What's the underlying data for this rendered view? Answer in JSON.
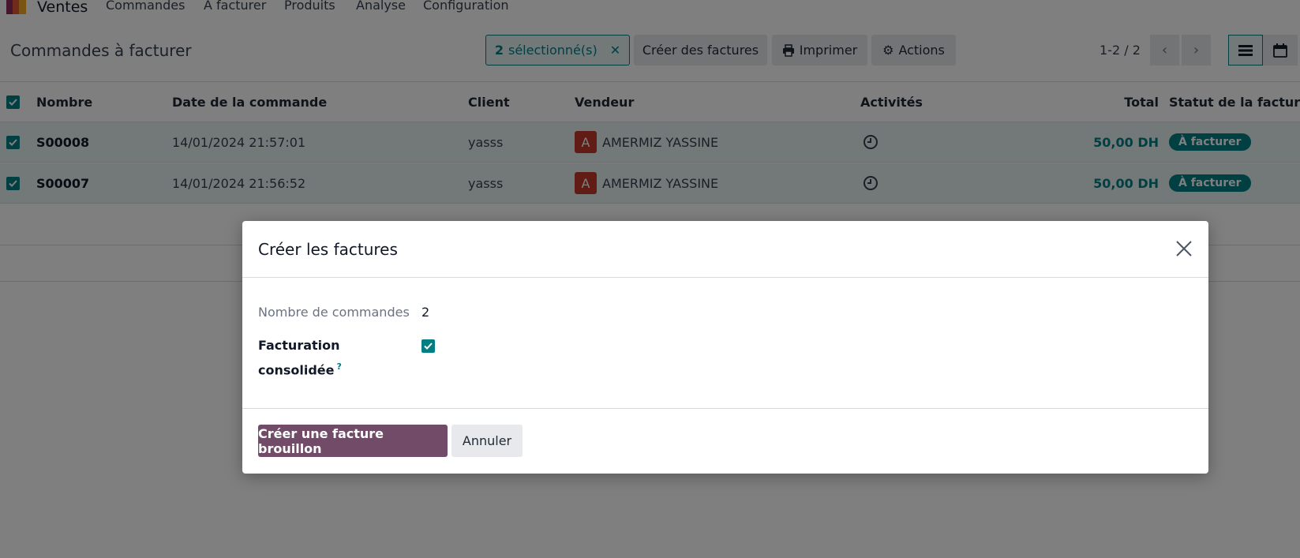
{
  "nav": {
    "app_name": "Ventes",
    "menu": [
      "Commandes",
      "À facturer",
      "Produits",
      "Analyse",
      "Configuration"
    ]
  },
  "control_panel": {
    "title": "Commandes à facturer",
    "selected_count": "2",
    "selected_label": "sélectionné(s)",
    "create_invoices": "Créer des factures",
    "print": "Imprimer",
    "actions": "Actions",
    "pager": "1-2 / 2"
  },
  "table": {
    "headers": {
      "number": "Nombre",
      "date": "Date de la commande",
      "client": "Client",
      "salesperson": "Vendeur",
      "activities": "Activités",
      "total": "Total",
      "invoice_status": "Statut de la facture"
    },
    "rows": [
      {
        "number": "S00008",
        "date": "14/01/2024 21:57:01",
        "client": "yasss",
        "avatar": "A",
        "salesperson": "AMERMIZ YASSINE",
        "total": "50,00 DH",
        "status": "À facturer"
      },
      {
        "number": "S00007",
        "date": "14/01/2024 21:56:52",
        "client": "yasss",
        "avatar": "A",
        "salesperson": "AMERMIZ YASSINE",
        "total": "50,00 DH",
        "status": "À facturer"
      }
    ]
  },
  "modal": {
    "title": "Créer les factures",
    "orders_label": "Nombre de commandes",
    "orders_value": "2",
    "consolidated_label_1": "Facturation",
    "consolidated_label_2": "consolidée",
    "help_mark": "?",
    "consolidated_checked": true,
    "primary_button": "Créer une facture brouillon",
    "cancel_button": "Annuler"
  },
  "colors": {
    "accent": "#017e84",
    "primary": "#714b67",
    "avatar": "#c0392b"
  }
}
